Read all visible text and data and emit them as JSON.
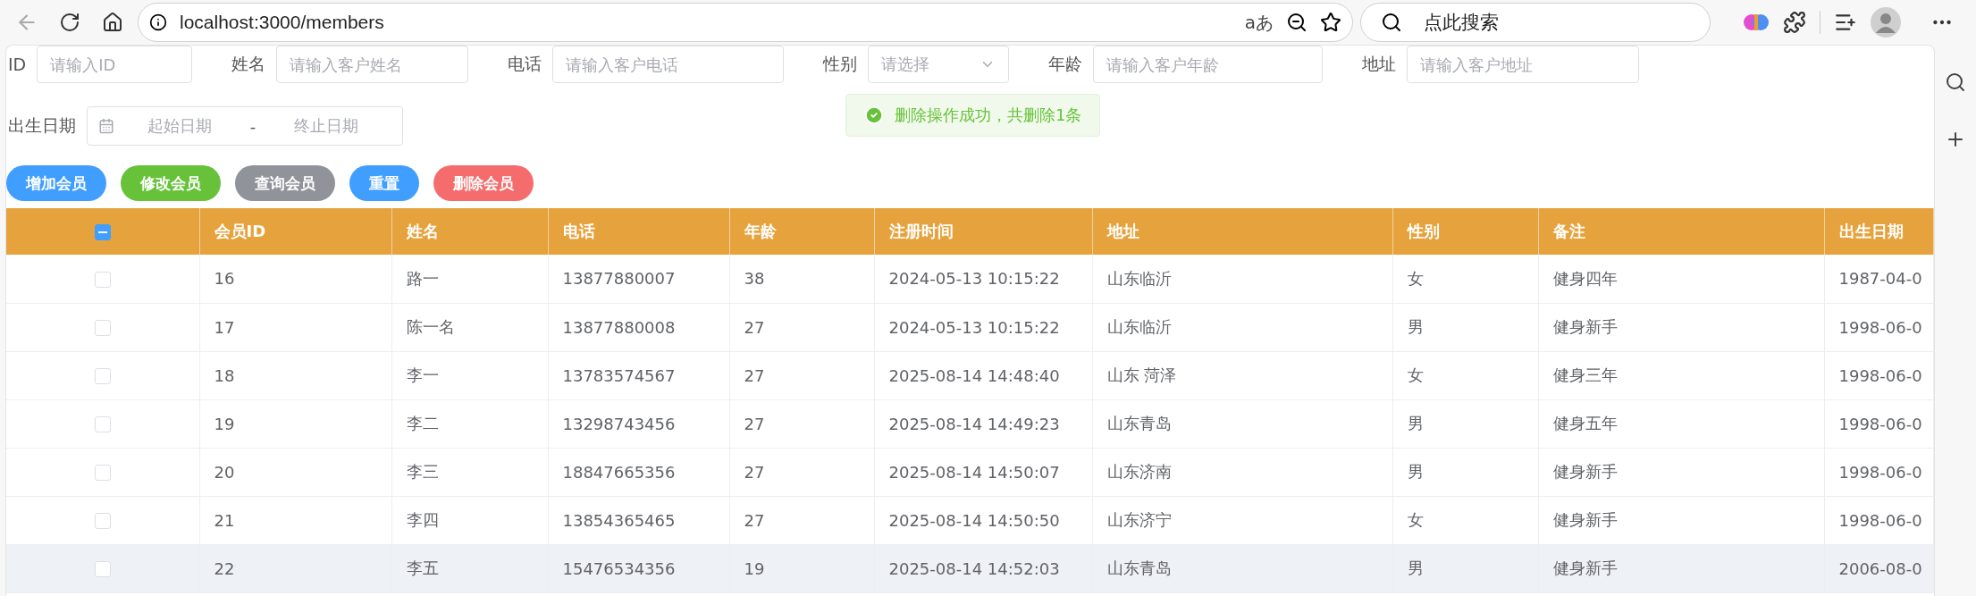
{
  "browser": {
    "url": "localhost:3000/members",
    "reader_glyph": "aあ",
    "search_placeholder": "点此搜索"
  },
  "filters": [
    {
      "label": "ID",
      "placeholder": "请输入ID",
      "kind": "input"
    },
    {
      "label": "姓名",
      "placeholder": "请输入客户姓名",
      "kind": "input"
    },
    {
      "label": "电话",
      "placeholder": "请输入客户电话",
      "kind": "input"
    },
    {
      "label": "性别",
      "placeholder": "请选择",
      "kind": "select"
    },
    {
      "label": "年龄",
      "placeholder": "请输入客户年龄",
      "kind": "input"
    },
    {
      "label": "地址",
      "placeholder": "请输入客户地址",
      "kind": "input"
    }
  ],
  "date_range": {
    "label": "出生日期",
    "start_placeholder": "起始日期",
    "separator": "-",
    "end_placeholder": "终止日期"
  },
  "buttons": [
    {
      "label": "增加会员",
      "color": "#409eff"
    },
    {
      "label": "修改会员",
      "color": "#67c23a"
    },
    {
      "label": "查询会员",
      "color": "#909399"
    },
    {
      "label": "重置",
      "color": "#409eff"
    },
    {
      "label": "删除会员",
      "color": "#f56c6c"
    }
  ],
  "toast": {
    "kind": "success",
    "message": "删除操作成功，共删除1条"
  },
  "table": {
    "select_all": {
      "indeterminate": true
    },
    "columns": [
      "会员ID",
      "姓名",
      "电话",
      "年龄",
      "注册时间",
      "地址",
      "性别",
      "备注",
      "出生日期"
    ],
    "rows": [
      {
        "checked": false,
        "highlighted": false,
        "cells": [
          "16",
          "路一",
          "13877880007",
          "38",
          "2024-05-13 10:15:22",
          "山东临沂",
          "女",
          "健身四年",
          "1987-04-0"
        ]
      },
      {
        "checked": false,
        "highlighted": false,
        "cells": [
          "17",
          "陈一名",
          "13877880008",
          "27",
          "2024-05-13 10:15:22",
          "山东临沂",
          "男",
          "健身新手",
          "1998-06-0"
        ]
      },
      {
        "checked": false,
        "highlighted": false,
        "cells": [
          "18",
          "李一",
          "13783574567",
          "27",
          "2025-08-14 14:48:40",
          "山东 菏泽",
          "女",
          "健身三年",
          "1998-06-0"
        ]
      },
      {
        "checked": false,
        "highlighted": false,
        "cells": [
          "19",
          "李二",
          "13298743456",
          "27",
          "2025-08-14 14:49:23",
          "山东青岛",
          "男",
          "健身五年",
          "1998-06-0"
        ]
      },
      {
        "checked": false,
        "highlighted": false,
        "cells": [
          "20",
          "李三",
          "18847665356",
          "27",
          "2025-08-14 14:50:07",
          "山东济南",
          "男",
          "健身新手",
          "1998-06-0"
        ]
      },
      {
        "checked": false,
        "highlighted": false,
        "cells": [
          "21",
          "李四",
          "13854365465",
          "27",
          "2025-08-14 14:50:50",
          "山东济宁",
          "女",
          "健身新手",
          "1998-06-0"
        ]
      },
      {
        "checked": false,
        "highlighted": true,
        "cells": [
          "22",
          "李五",
          "15476534356",
          "19",
          "2025-08-14 14:52:03",
          "山东青岛",
          "男",
          "健身新手",
          "2006-08-0"
        ]
      }
    ]
  }
}
